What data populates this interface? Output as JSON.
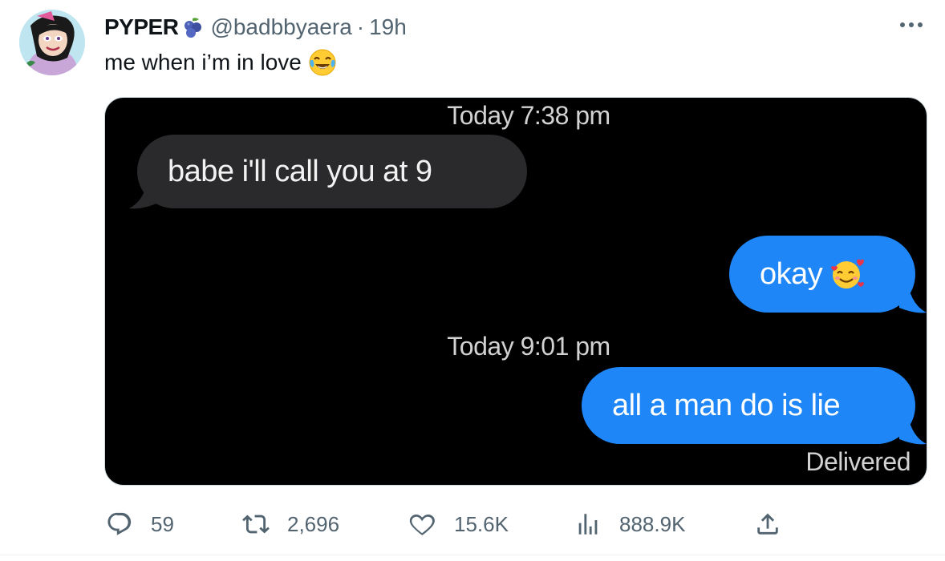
{
  "tweet": {
    "display_name": "PYPER",
    "name_emoji": "blueberries-emoji",
    "handle": "@badbbyaera",
    "separator": "·",
    "time": "19h",
    "text": "me when i’m in love",
    "text_emoji": "face-with-tears-of-joy-emoji"
  },
  "media": {
    "messages": [
      {
        "type": "timestamp",
        "text": "Today 7:38 pm"
      },
      {
        "type": "incoming",
        "text": "babe i'll call you at 9"
      },
      {
        "type": "outgoing",
        "text": "okay",
        "emoji": "smiling-face-with-hearts-emoji"
      },
      {
        "type": "timestamp",
        "text": "Today 9:01 pm"
      },
      {
        "type": "outgoing",
        "text": "all a man do is lie"
      }
    ],
    "status": "Delivered"
  },
  "actions": {
    "reply_count": "59",
    "retweet_count": "2,696",
    "like_count": "15.6K",
    "view_count": "888.9K"
  },
  "colors": {
    "imessage_blue": "#1e86f7",
    "incoming_bubble": "#2a2a2c",
    "secondary_text": "#536471"
  }
}
